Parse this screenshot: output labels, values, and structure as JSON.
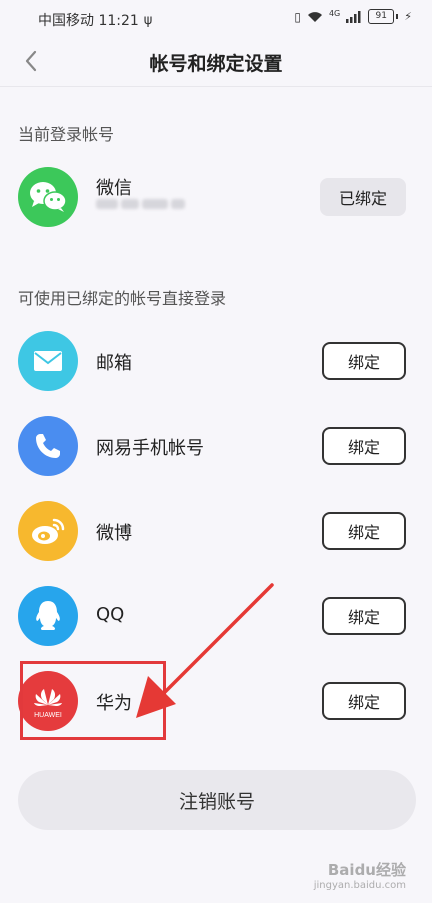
{
  "status_bar": {
    "carrier_time": "中国移动 11:21",
    "signal_type": "4G",
    "battery": "91"
  },
  "header": {
    "title": "帐号和绑定设置"
  },
  "current": {
    "section_label": "当前登录帐号",
    "account": {
      "name": "微信",
      "button_label": "已绑定",
      "icon": "wechat-icon",
      "color": "#3cc85a"
    }
  },
  "bindable": {
    "section_label": "可使用已绑定的帐号直接登录",
    "items": [
      {
        "name": "邮箱",
        "button_label": "绑定",
        "icon": "mail-icon",
        "color": "#3ec7e4"
      },
      {
        "name": "网易手机帐号",
        "button_label": "绑定",
        "icon": "phone-icon",
        "color": "#4a8df0"
      },
      {
        "name": "微博",
        "button_label": "绑定",
        "icon": "weibo-icon",
        "color": "#f7b82e"
      },
      {
        "name": "QQ",
        "button_label": "绑定",
        "icon": "qq-icon",
        "color": "#27a5ec"
      },
      {
        "name": "华为",
        "button_label": "绑定",
        "icon": "huawei-icon",
        "color": "#e53b3d",
        "logo_text": "HUAWEI"
      }
    ]
  },
  "logout": {
    "label": "注销账号"
  },
  "watermark": {
    "line1": "Baidu经验",
    "line2": "jingyan.baidu.com"
  }
}
